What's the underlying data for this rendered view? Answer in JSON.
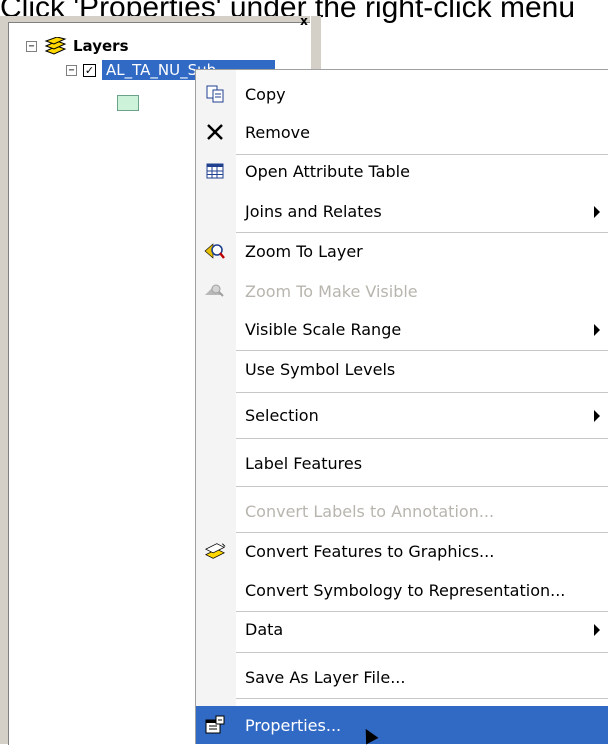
{
  "caption": "Click 'Properties' under the right-click menu",
  "toc": {
    "close_glyph": "x",
    "layers_label": "Layers",
    "layer_name": "AL_TA_NU_Sub",
    "expander_glyph": "−",
    "checkbox_glyph": "✓"
  },
  "menu": {
    "items": [
      {
        "label": "Copy",
        "icon": "copy-icon",
        "enabled": true
      },
      {
        "label": "Remove",
        "icon": "remove-icon",
        "enabled": true
      },
      {
        "label": "Open Attribute Table",
        "icon": "table-icon",
        "enabled": true
      },
      {
        "label": "Joins and Relates",
        "icon": "",
        "enabled": true,
        "submenu": true
      },
      {
        "label": "Zoom To Layer",
        "icon": "zoom-to-layer-icon",
        "enabled": true
      },
      {
        "label": "Zoom To Make Visible",
        "icon": "zoom-to-visible-icon",
        "enabled": false
      },
      {
        "label": "Visible Scale Range",
        "icon": "",
        "enabled": true,
        "submenu": true
      },
      {
        "label": "Use Symbol Levels",
        "icon": "",
        "enabled": true
      },
      {
        "label": "Selection",
        "icon": "",
        "enabled": true,
        "submenu": true
      },
      {
        "label": "Label Features",
        "icon": "",
        "enabled": true
      },
      {
        "label": "Convert Labels to Annotation...",
        "icon": "",
        "enabled": false
      },
      {
        "label": "Convert Features to Graphics...",
        "icon": "convert-graphics-icon",
        "enabled": true
      },
      {
        "label": "Convert Symbology to Representation...",
        "icon": "",
        "enabled": true
      },
      {
        "label": "Data",
        "icon": "",
        "enabled": true,
        "submenu": true
      },
      {
        "label": "Save As Layer File...",
        "icon": "",
        "enabled": true
      },
      {
        "label": "Properties...",
        "icon": "properties-icon",
        "enabled": true,
        "selected": true
      }
    ]
  },
  "colors": {
    "selection": "#316ac5",
    "disabled_text": "#b7b5ae"
  }
}
